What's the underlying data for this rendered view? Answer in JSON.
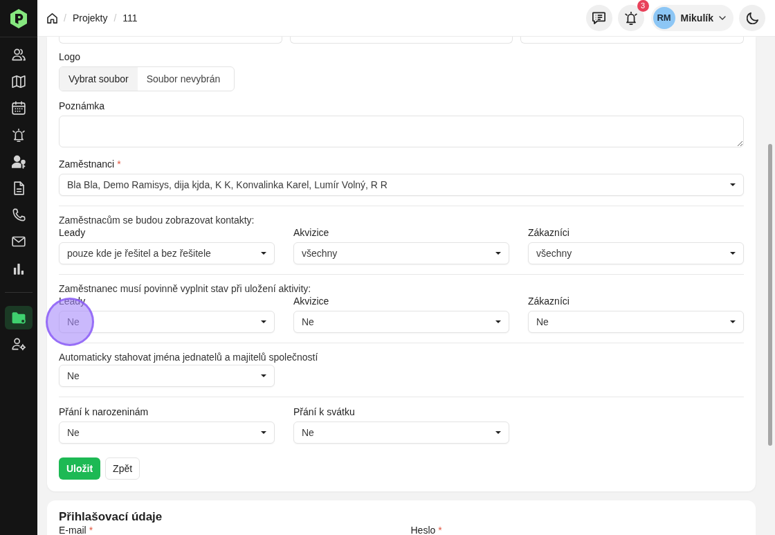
{
  "sidebar": {
    "groups": [
      {
        "items": [
          {
            "kind": "contacts",
            "selected": false
          },
          {
            "kind": "map",
            "selected": false
          },
          {
            "kind": "calendar",
            "selected": false
          },
          {
            "kind": "reminders",
            "selected": false
          },
          {
            "kind": "leads",
            "selected": false
          },
          {
            "kind": "documents",
            "selected": false
          },
          {
            "kind": "calls",
            "selected": false
          },
          {
            "kind": "mail",
            "selected": false
          },
          {
            "kind": "statistics",
            "selected": false
          }
        ]
      },
      {
        "items": [
          {
            "kind": "projects",
            "selected": true
          },
          {
            "kind": "users",
            "selected": false
          }
        ]
      }
    ]
  },
  "header": {
    "breadcrumb": [
      {
        "kind": "home"
      },
      {
        "kind": "link",
        "separator": "/",
        "label": "Projekty"
      },
      {
        "kind": "current",
        "separator": "/",
        "label": "111"
      }
    ],
    "actions": [
      {
        "kind": "messages"
      },
      {
        "kind": "notifications",
        "badge": "3"
      },
      {
        "kind": "user",
        "initials": "RM",
        "name": "Mikulík"
      },
      {
        "kind": "theme"
      }
    ]
  },
  "form": {
    "cut_fields": [
      {
        "kind": "input"
      },
      {
        "kind": "input"
      },
      {
        "kind": "input"
      }
    ],
    "logo": {
      "label": "Logo",
      "button": "Vybrat soubor",
      "status": "Soubor nevybrán"
    },
    "note": {
      "label": "Poznámka"
    },
    "employees": {
      "label": "Zaměstnanci",
      "required_mark": "*",
      "value": "Bla Bla, Demo Ramisys, dija kjda, K K, Konvalinka Karel, Lumír Volný, R R"
    },
    "sections": [
      {
        "intro": "Zaměstnacům se budou zobrazovat kontakty:",
        "fields": [
          {
            "label": "Leady",
            "value": "pouze kde je řešitel a bez řešitele",
            "tap_marker": false
          },
          {
            "label": "Akvizice",
            "value": "všechny",
            "tap_marker": false
          },
          {
            "label": "Zákazníci",
            "value": "všechny",
            "tap_marker": false
          }
        ]
      },
      {
        "intro": "Zaměstnanec musí povinně vyplnit stav při uložení aktivity:",
        "fields": [
          {
            "label": "Leady",
            "value": "Ne",
            "tap_marker": true
          },
          {
            "label": "Akvizice",
            "value": "Ne",
            "tap_marker": false
          },
          {
            "label": "Zákazníci",
            "value": "Ne",
            "tap_marker": false
          }
        ]
      },
      {
        "intro": "Automaticky stahovat jména jednatelů a majitelů společností",
        "fields": [
          {
            "value": "Ne",
            "tap_marker": false
          }
        ]
      },
      {
        "fields": [
          {
            "label": "Přání k narozeninám",
            "value": "Ne",
            "tap_marker": false
          },
          {
            "label": "Přání k svátku",
            "value": "Ne",
            "tap_marker": false
          }
        ]
      }
    ],
    "buttons": [
      {
        "kind": "primary",
        "label": "Uložit"
      },
      {
        "kind": "secondary",
        "label": "Zpět"
      }
    ]
  },
  "login_card": {
    "title": "Přihlašovací údaje",
    "fields": [
      {
        "label": "E-mail",
        "required_mark": "*"
      },
      {
        "label": "Heslo",
        "required_mark": "*"
      }
    ]
  }
}
